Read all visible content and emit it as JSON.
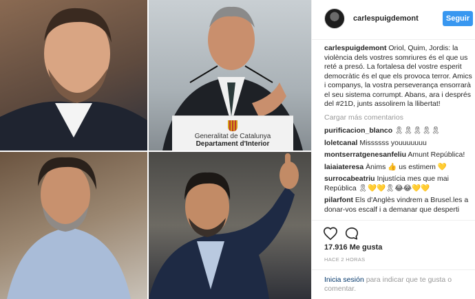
{
  "post": {
    "username": "carlespuigdemont",
    "follow_label": "Seguir",
    "caption_user": "carlespuigdemont",
    "caption_text": "Oriol, Quim, Jordis: la violència dels vostres somriures és el que us reté a presó. La fortalesa del vostre esperit democràtic és el que els provoca terror. Amics i companys, la vostra perseverança ensorrarà el seu sistema corrumpt. Abans, ara i després del #21D, junts assolirem la llibertat!",
    "load_more": "Cargar más comentarios",
    "comments": [
      {
        "user": "purificacion_blanco",
        "text": "🎗🎗🎗🎗🎗"
      },
      {
        "user": "loletcanal",
        "text": "Missssss youuuuuuu"
      },
      {
        "user": "montserratgenesanfeliu",
        "text": "Amunt República!"
      },
      {
        "user": "laiaiateresa",
        "text": "Ànims 👍 us estimem 💛"
      },
      {
        "user": "surrocabeatriu",
        "text": "Injustícia mes que mai República 🎗💛💛🎗😂😂💛💛"
      },
      {
        "user": "pilarfont",
        "text": "Els d'Anglès vindrem a Brusel.les a donar-vos escalf i a demanar que desperti"
      }
    ],
    "likes": "17.916 Me gusta",
    "time": "HACE 2 HORAS",
    "login_link": "Inicia sesión",
    "login_text": " para indicar que te gusta o comentar."
  },
  "photos": {
    "podium_line1": "Generalitat de Catalunya",
    "podium_line2": "Departament d'Interior"
  },
  "icons": {
    "like": "heart-outline-icon",
    "comment": "speech-bubble-icon"
  },
  "colors": {
    "follow_button": "#3897f0",
    "link": "#003569",
    "muted": "#999999"
  }
}
